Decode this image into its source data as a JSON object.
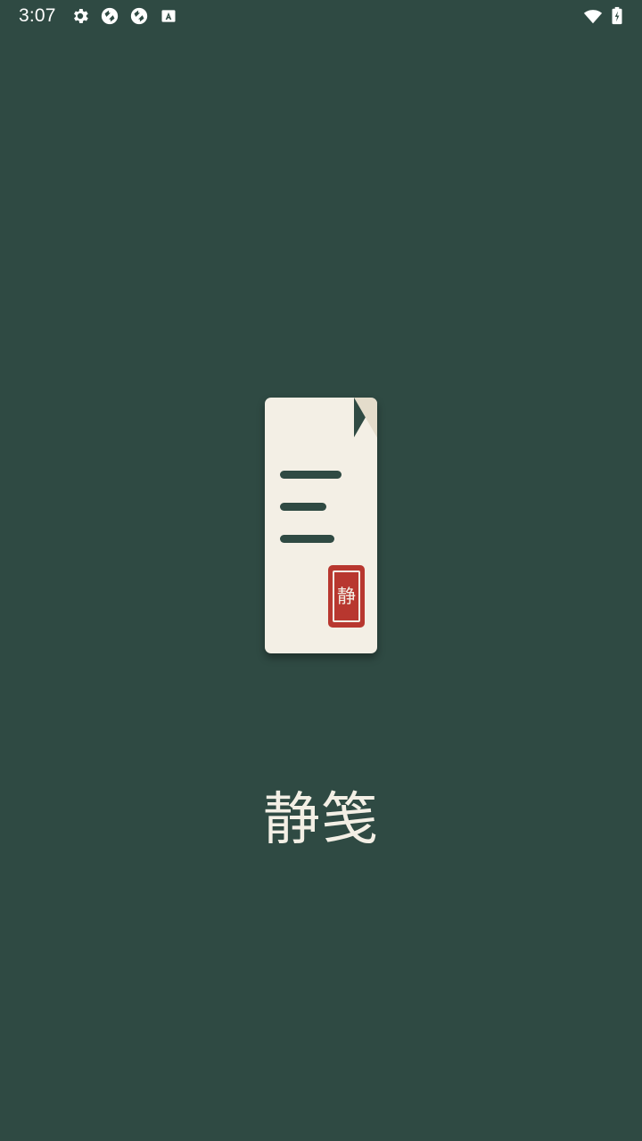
{
  "status_bar": {
    "time": "3:07",
    "left_icons": [
      "settings-icon",
      "sync-icon",
      "sync-icon",
      "keyboard-a-icon"
    ],
    "right_icons": [
      "wifi-icon",
      "battery-charging-icon"
    ]
  },
  "splash": {
    "seal_char": "静",
    "app_title": "静笺"
  },
  "colors": {
    "background": "#2f4a43",
    "paper": "#f3efe5",
    "seal_red": "#b8372f"
  }
}
